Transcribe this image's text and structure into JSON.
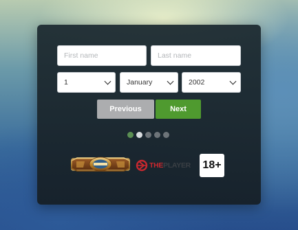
{
  "form": {
    "first_name_placeholder": "First name",
    "last_name_placeholder": "Last name",
    "day_value": "1",
    "month_value": "January",
    "year_value": "2002"
  },
  "buttons": {
    "previous_label": "Previous",
    "next_label": "Next"
  },
  "progress": {
    "total_steps": 5,
    "current_step": 2
  },
  "logos": {
    "theplayer_text_red": "THE",
    "theplayer_text_gray": "PLAYER",
    "age_badge": "18+"
  },
  "colors": {
    "next_button": "#4f9a2f",
    "previous_button": "#acadaf",
    "panel": "#1b2830"
  }
}
